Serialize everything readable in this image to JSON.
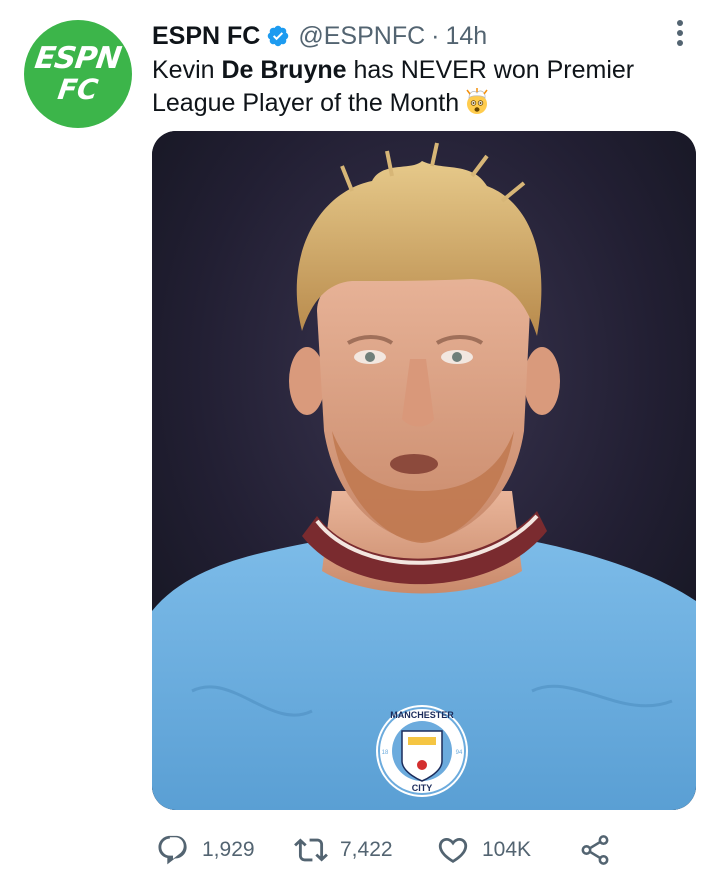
{
  "account": {
    "display_name": "ESPN FC",
    "handle": "@ESPNFC",
    "separator": "·",
    "time": "14h",
    "avatar_line1": "ESPN",
    "avatar_line2": "FC",
    "verified": true
  },
  "tweet": {
    "text_part1": "Kevin ",
    "text_bold": "De Bruyne",
    "text_part2": " has NEVER won Premier League Player of the Month",
    "emoji": "exploding-head-emoji",
    "image_badge_top": "MANCHESTER",
    "image_badge_bottom": "CITY",
    "image_badge_left": "18",
    "image_badge_right": "94"
  },
  "actions": {
    "replies": "1,929",
    "retweets": "7,422",
    "likes": "104K"
  },
  "icons": {
    "verified": "verified-badge-icon",
    "more": "more-options-icon",
    "reply": "reply-icon",
    "retweet": "retweet-icon",
    "like": "heart-icon",
    "share": "share-icon"
  },
  "colors": {
    "avatar_bg": "#3cb54a",
    "verified": "#1d9bf0",
    "secondary_text": "#536471",
    "jersey": "#6caddf",
    "collar": "#7a2b2f"
  }
}
